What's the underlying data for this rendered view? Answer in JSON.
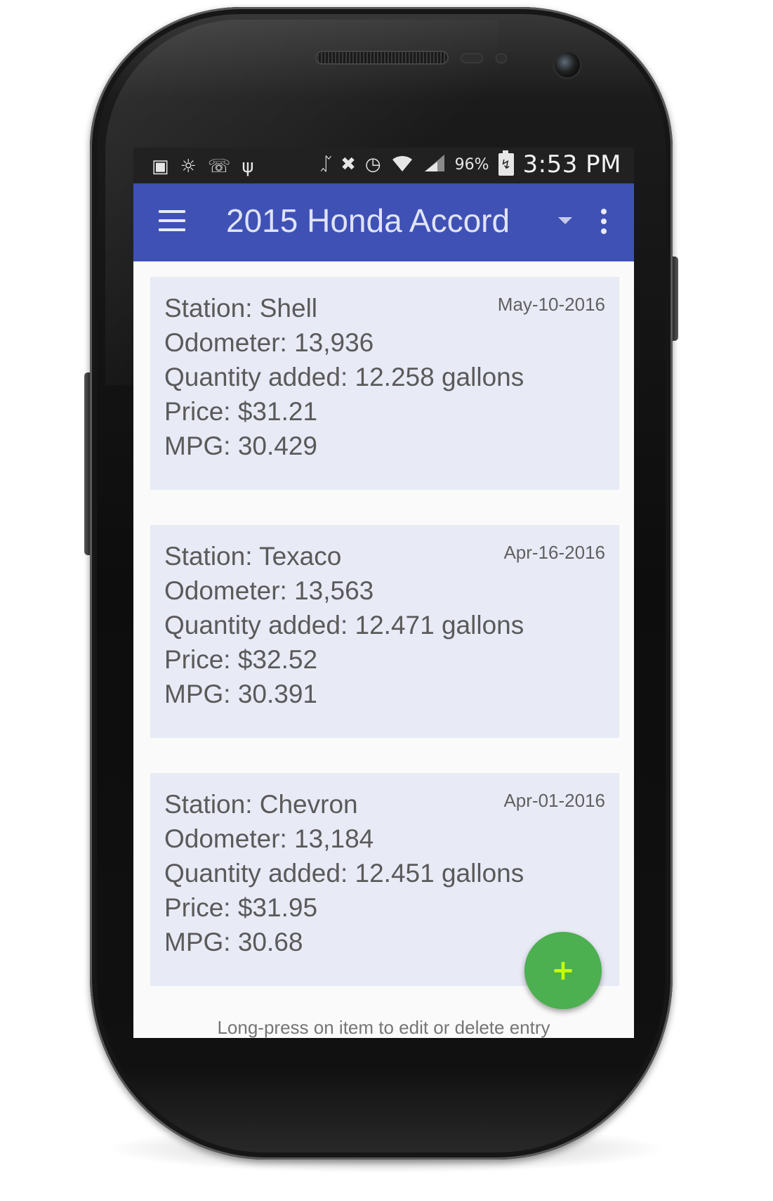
{
  "status_bar": {
    "battery_percent": "96%",
    "time": "3:53 PM",
    "icons": [
      "notification-icon",
      "brightness-icon",
      "missed-call-icon",
      "usb-icon",
      "bluetooth-icon",
      "mute-icon",
      "alarm-icon",
      "wifi-icon",
      "signal-icon",
      "battery-charging-icon"
    ]
  },
  "app_bar": {
    "title": "2015 Honda Accord"
  },
  "entries": [
    {
      "station": "Station: Shell",
      "date": "May-10-2016",
      "odometer": "Odometer: 13,936",
      "quantity": "Quantity added: 12.258 gallons",
      "price": "Price: $31.21",
      "mpg": "MPG: 30.429"
    },
    {
      "station": "Station: Texaco",
      "date": "Apr-16-2016",
      "odometer": "Odometer: 13,563",
      "quantity": "Quantity added: 12.471 gallons",
      "price": "Price: $32.52",
      "mpg": "MPG: 30.391"
    },
    {
      "station": "Station: Chevron",
      "date": "Apr-01-2016",
      "odometer": "Odometer: 13,184",
      "quantity": "Quantity added: 12.451 gallons",
      "price": "Price: $31.95",
      "mpg": "MPG: 30.68"
    }
  ],
  "fab": {
    "label": "+"
  },
  "footer_hint": "Long-press on item to edit or delete entry",
  "colors": {
    "app_bar": "#3f51b5",
    "card": "#e8eaf6",
    "fab": "#4caf50",
    "fab_icon": "#c6ff00",
    "status_bar": "#212121"
  }
}
